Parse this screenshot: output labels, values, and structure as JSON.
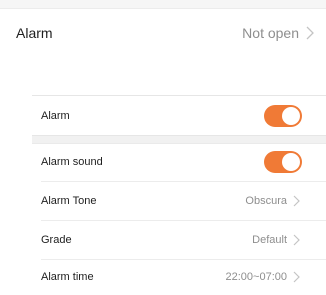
{
  "header": {
    "label": "Alarm",
    "status": "Not open"
  },
  "settings": {
    "alarm": {
      "label": "Alarm",
      "enabled": true
    },
    "alarm_sound": {
      "label": "Alarm sound",
      "enabled": true
    },
    "alarm_tone": {
      "label": "Alarm Tone",
      "value": "Obscura"
    },
    "grade": {
      "label": "Grade",
      "value": "Default"
    },
    "alarm_time": {
      "label": "Alarm time",
      "value": "22:00~07:00"
    }
  },
  "colors": {
    "toggle_on": "#f07a36",
    "value_text": "#8e8e8e",
    "chevron": "#c4c4c4"
  },
  "icons": {
    "chevron": "chevron-right-icon"
  }
}
